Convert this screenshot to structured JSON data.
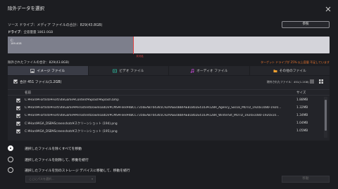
{
  "window": {
    "title": "除外データを選択"
  },
  "source": {
    "label": "ソース ドライブ：メディア ファイルの合計：829(43.8GB)",
    "browse_button": "参照",
    "drive_label": "ドライブ",
    "drive_info": "：全容量量 1863.0GB"
  },
  "capacity": {
    "drive_letter": "C:",
    "used_text": "189.4GB",
    "used_fraction": 0.39,
    "marker_fraction": 0.39,
    "marker_label": "未対処"
  },
  "selection": {
    "label": "除外されたファイルの合計：829(43.8GB)",
    "warning": "ターゲット ドライブが 25% 以上容量 不足しています"
  },
  "tabs": [
    {
      "label": "イメージ ファイル",
      "icon": "image-icon",
      "active": true
    },
    {
      "label": "ビデオ ファイル",
      "icon": "video-icon",
      "active": false
    },
    {
      "label": "オーディオ ファイル",
      "icon": "audio-icon",
      "active": false
    },
    {
      "label": "その他のファイル",
      "icon": "folder-icon",
      "active": false
    }
  ],
  "panel": {
    "total_label": "合計 451 ファイル(1.2GB)",
    "excluded_label": "除外されたファイル：451(1.2GB)",
    "columns": {
      "name": "名前",
      "size": "サイズ"
    },
    "rows": [
      {
        "name": "C:¥Hard¥Fortnite¥FortniteGame¥Content¥Splash¥Splash.bmp",
        "size": "1.88MB"
      },
      {
        "name": "C:¥Hard¥Fortnite¥FortniteGame¥PersistentDownloadDir¥CMS¥Files¥4BCC7356EAB704365C92AAEE0BBFAEB1802E4103¥128R_Agency_Social_MOTD_1920x1080-1920...",
        "size": "1.32MB"
      },
      {
        "name": "C:¥Hard¥Fortnite¥FortniteGame¥PersistentDownloadDir¥CMS¥Files¥4BCC7356EAB704365C92AAEE0BBFAEB1802E4103¥128R_WinterSlt_MOTD_1920x1080-1920x10...",
        "size": "1.34MB"
      },
      {
        "name": "C:¥Hard¥IGA_DSB¥Screenshots¥スクリーンショット (194).png",
        "size": "1.04MB"
      },
      {
        "name": "C:¥Hard¥IGA_DSB¥Screenshots¥スクリーンショット (195).png",
        "size": "1.05MB"
      }
    ]
  },
  "options": [
    {
      "label": "選択したファイルを除くすべてを移動",
      "selected": true
    },
    {
      "label": "選択したファイルを削除して、移動を続行",
      "selected": false
    },
    {
      "label": "選択したファイルを別のストレージ デバイスに移動して、移動を続行",
      "selected": false
    }
  ],
  "destination": {
    "placeholder": "ここにパスを選択...",
    "button": "移動"
  },
  "colors": {
    "accent_red": "#e14242",
    "warning_orange": "#f07830",
    "active_tab": "#3a3c46"
  }
}
